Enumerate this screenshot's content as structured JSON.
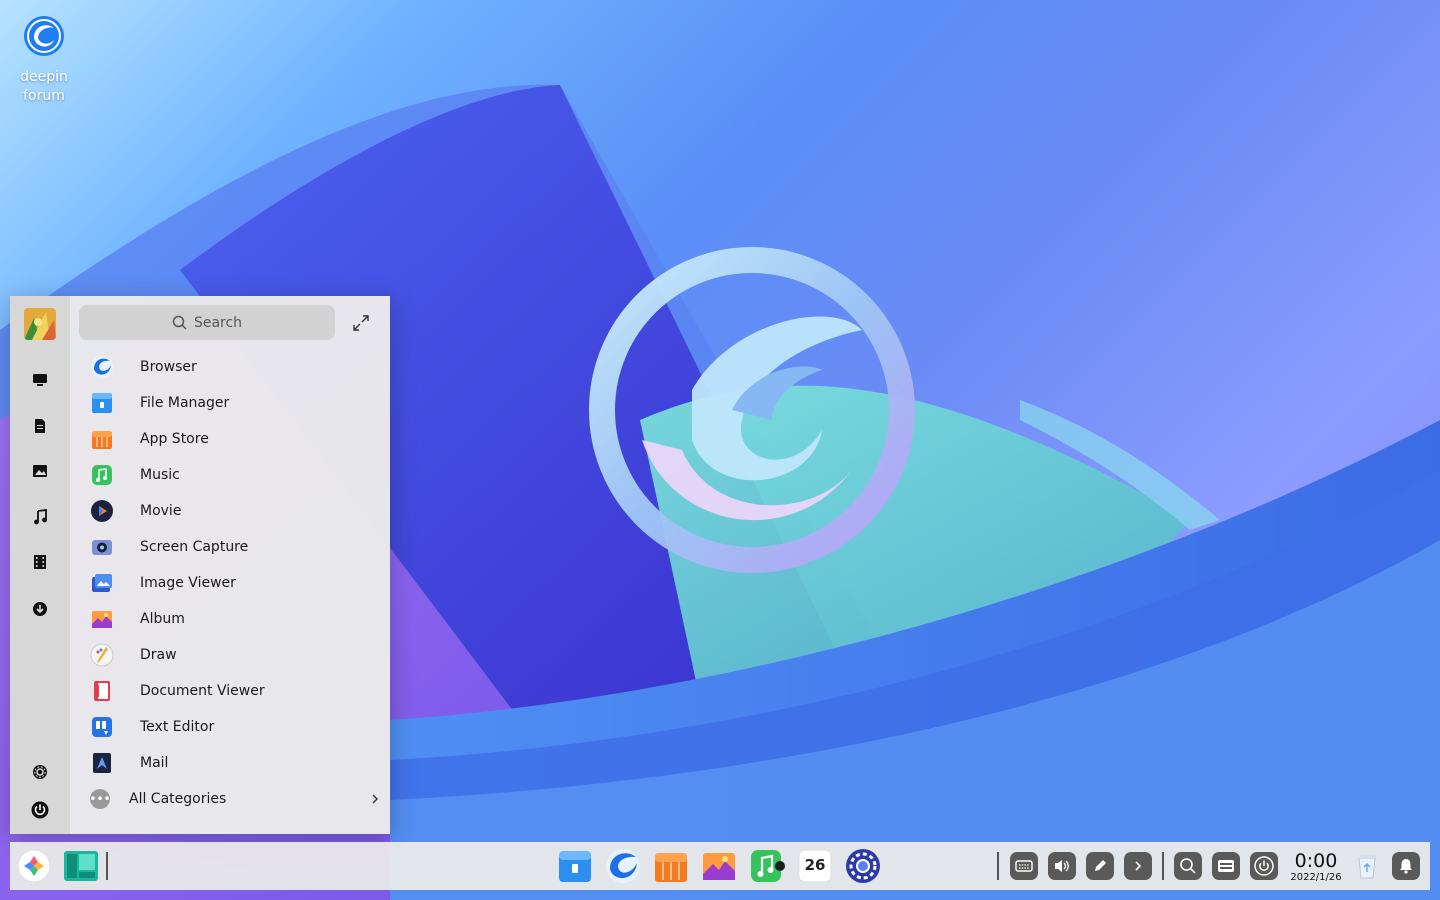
{
  "desktop": {
    "icons": [
      {
        "label": "deepin forum",
        "icon": "deepin-logo-icon"
      }
    ]
  },
  "launcher": {
    "search": {
      "placeholder": "Search"
    },
    "rail": [
      "computer-icon",
      "document-icon",
      "picture-icon",
      "music-icon",
      "video-icon",
      "download-icon",
      "settings-icon",
      "power-icon"
    ],
    "apps": [
      {
        "label": "Browser",
        "icon": "browser-icon"
      },
      {
        "label": "File Manager",
        "icon": "file-manager-icon"
      },
      {
        "label": "App Store",
        "icon": "app-store-icon"
      },
      {
        "label": "Music",
        "icon": "music-app-icon"
      },
      {
        "label": "Movie",
        "icon": "movie-icon"
      },
      {
        "label": "Screen Capture",
        "icon": "screen-capture-icon"
      },
      {
        "label": "Image Viewer",
        "icon": "image-viewer-icon"
      },
      {
        "label": "Album",
        "icon": "album-icon"
      },
      {
        "label": "Draw",
        "icon": "draw-icon"
      },
      {
        "label": "Document Viewer",
        "icon": "document-viewer-icon"
      },
      {
        "label": "Text Editor",
        "icon": "text-editor-icon"
      },
      {
        "label": "Mail",
        "icon": "mail-icon"
      }
    ],
    "all_categories": "All Categories"
  },
  "dock": {
    "apps": [
      "launcher-icon",
      "multitask-view-icon",
      "file-manager-icon",
      "browser-icon",
      "app-store-icon",
      "album-icon",
      "music-app-icon",
      "calendar-icon",
      "control-center-icon"
    ],
    "calendar_day": "26",
    "tray": [
      "keyboard-icon",
      "volume-icon",
      "pen-icon",
      "expand-arrow-icon",
      "search-icon",
      "onboard-keyboard-icon",
      "power-icon"
    ],
    "clock": {
      "time": "0:00",
      "date": "2022/1/26"
    },
    "end": [
      "trash-icon",
      "notification-bell-icon"
    ]
  }
}
